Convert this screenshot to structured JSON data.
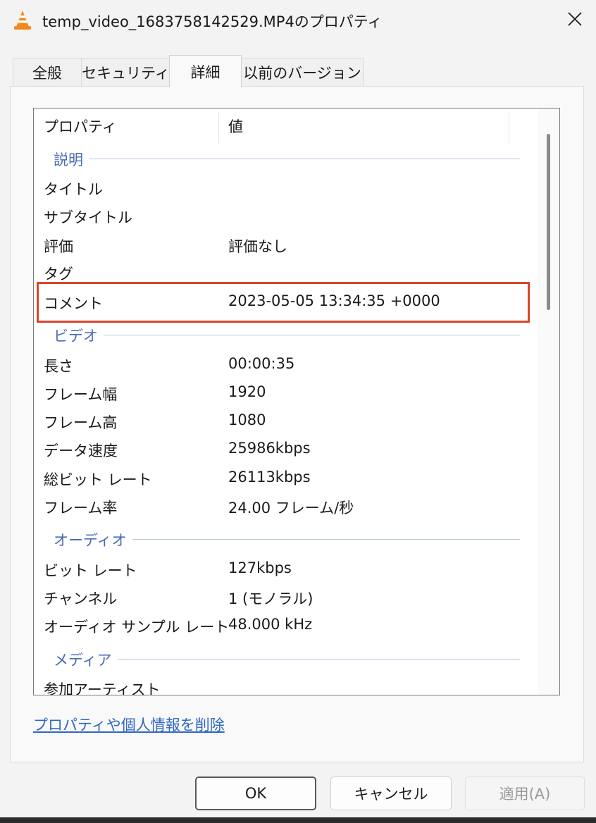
{
  "window": {
    "title": "temp_video_1683758142529.MP4のプロパティ",
    "close_icon": "close-icon",
    "app_icon": "vlc-cone-icon"
  },
  "tabs": [
    {
      "label": "全般"
    },
    {
      "label": "セキュリティ"
    },
    {
      "label": "詳細"
    },
    {
      "label": "以前のバージョン"
    }
  ],
  "list": {
    "columns": {
      "property": "プロパティ",
      "value": "値"
    },
    "groups": {
      "description": "説明",
      "video": "ビデオ",
      "audio": "オーディオ",
      "media": "メディア"
    },
    "rows": [
      {
        "name": "タイトル",
        "value": ""
      },
      {
        "name": "サブタイトル",
        "value": ""
      },
      {
        "name": "評価",
        "value": "評価なし"
      },
      {
        "name": "タグ",
        "value": ""
      },
      {
        "name": "コメント",
        "value": "2023-05-05 13:34:35 +0000"
      },
      {
        "name": "長さ",
        "value": "00:00:35"
      },
      {
        "name": "フレーム幅",
        "value": "1920"
      },
      {
        "name": "フレーム高",
        "value": "1080"
      },
      {
        "name": "データ速度",
        "value": "25986kbps"
      },
      {
        "name": "総ビット レート",
        "value": "26113kbps"
      },
      {
        "name": "フレーム率",
        "value": "24.00 フレーム/秒"
      },
      {
        "name": "ビット レート",
        "value": "127kbps"
      },
      {
        "name": "チャンネル",
        "value": "1 (モノラル)"
      },
      {
        "name": "オーディオ サンプル レート",
        "value": "48.000 kHz"
      },
      {
        "name": "参加アーティスト",
        "value": ""
      }
    ]
  },
  "remove_link": "プロパティや個人情報を削除",
  "buttons": {
    "ok": "OK",
    "cancel": "キャンセル",
    "apply": "適用(A)"
  },
  "colors": {
    "highlight": "#d9442a",
    "group_text": "#4a6bb5",
    "link": "#2f67c4"
  }
}
